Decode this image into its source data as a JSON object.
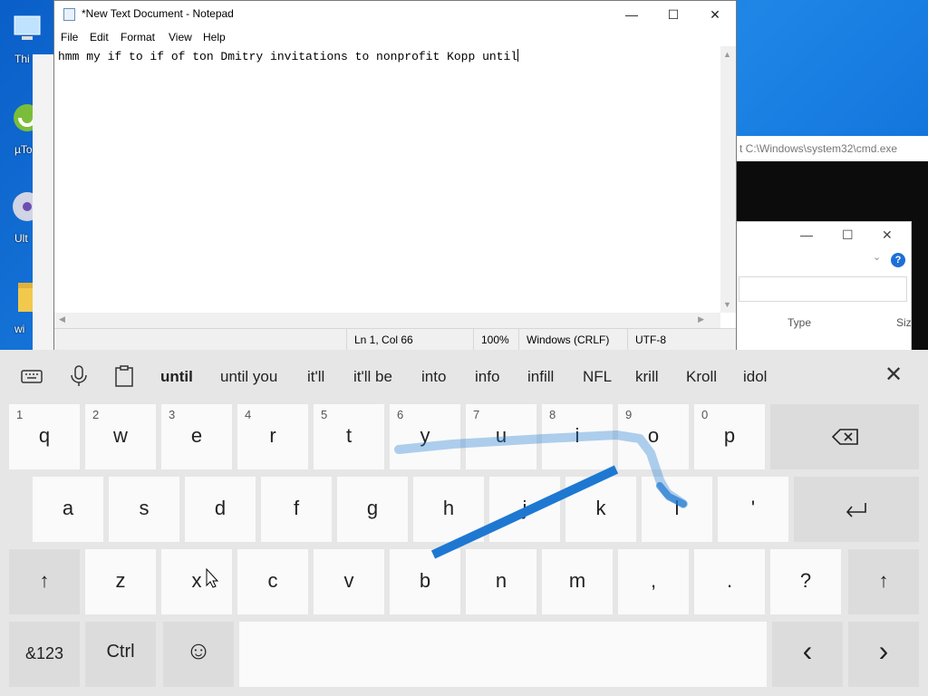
{
  "desktop": {
    "icons": [
      {
        "label": "Thi",
        "icon": "this-pc-icon"
      },
      {
        "label": "µTo",
        "icon": "utorrent-icon"
      },
      {
        "label": "Ult",
        "icon": "ultraiso-icon"
      },
      {
        "label": "wi",
        "icon": "folder-icon"
      }
    ]
  },
  "cmd_window": {
    "title": "t C:\\Windows\\system32\\cmd.exe"
  },
  "explorer_window": {
    "column_type": "Type",
    "column_size": "Siz"
  },
  "notepad": {
    "title": "*New Text Document - Notepad",
    "menu": [
      "File",
      "Edit",
      "Format",
      "View",
      "Help"
    ],
    "content": "hmm my if to if of ton Dmitry invitations to nonprofit Kopp until",
    "status": {
      "position": "Ln 1, Col 66",
      "zoom": "100%",
      "line_ending": "Windows (CRLF)",
      "encoding": "UTF-8"
    }
  },
  "keyboard": {
    "suggestions": [
      "until",
      "until you",
      "it'll",
      "it'll be",
      "into",
      "info",
      "infill",
      "NFL",
      "krill",
      "Kroll",
      "idol"
    ],
    "row1": [
      {
        "num": "1",
        "key": "q"
      },
      {
        "num": "2",
        "key": "w"
      },
      {
        "num": "3",
        "key": "e"
      },
      {
        "num": "4",
        "key": "r"
      },
      {
        "num": "5",
        "key": "t"
      },
      {
        "num": "6",
        "key": "y"
      },
      {
        "num": "7",
        "key": "u"
      },
      {
        "num": "8",
        "key": "i"
      },
      {
        "num": "9",
        "key": "o"
      },
      {
        "num": "0",
        "key": "p"
      }
    ],
    "row2": [
      "a",
      "s",
      "d",
      "f",
      "g",
      "h",
      "j",
      "k",
      "l",
      "'"
    ],
    "row3": [
      "z",
      "x",
      "c",
      "v",
      "b",
      "n",
      "m",
      ",",
      ".",
      "?"
    ],
    "bottom": {
      "symbols": "&123",
      "ctrl": "Ctrl",
      "emoji": "☺",
      "left": "‹",
      "right": "›"
    },
    "swipe_color": "#1e78d2"
  }
}
